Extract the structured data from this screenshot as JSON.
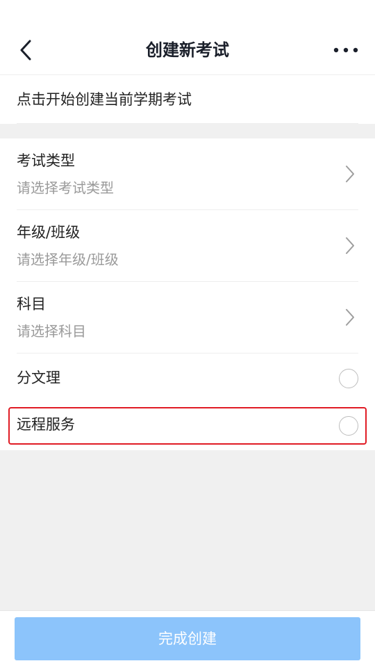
{
  "header": {
    "title": "创建新考试",
    "back_icon": "chevron-left-icon",
    "more_icon": "more-horizontal-icon"
  },
  "hint": {
    "text": "点击开始创建当前学期考试"
  },
  "form": {
    "exam_type": {
      "label": "考试类型",
      "placeholder": "请选择考试类型"
    },
    "grade_class": {
      "label": "年级/班级",
      "placeholder": "请选择年级/班级"
    },
    "subject": {
      "label": "科目",
      "placeholder": "请选择科目"
    },
    "arts_science": {
      "label": "分文理",
      "checked": false
    },
    "remote_service": {
      "label": "远程服务",
      "checked": false
    }
  },
  "footer": {
    "done_label": "完成创建"
  },
  "colors": {
    "accent": "#8cc4fb",
    "highlight": "#e01b24",
    "title": "#1a1f2a",
    "muted": "#9a9a9a",
    "background": "#f0f0f0"
  }
}
